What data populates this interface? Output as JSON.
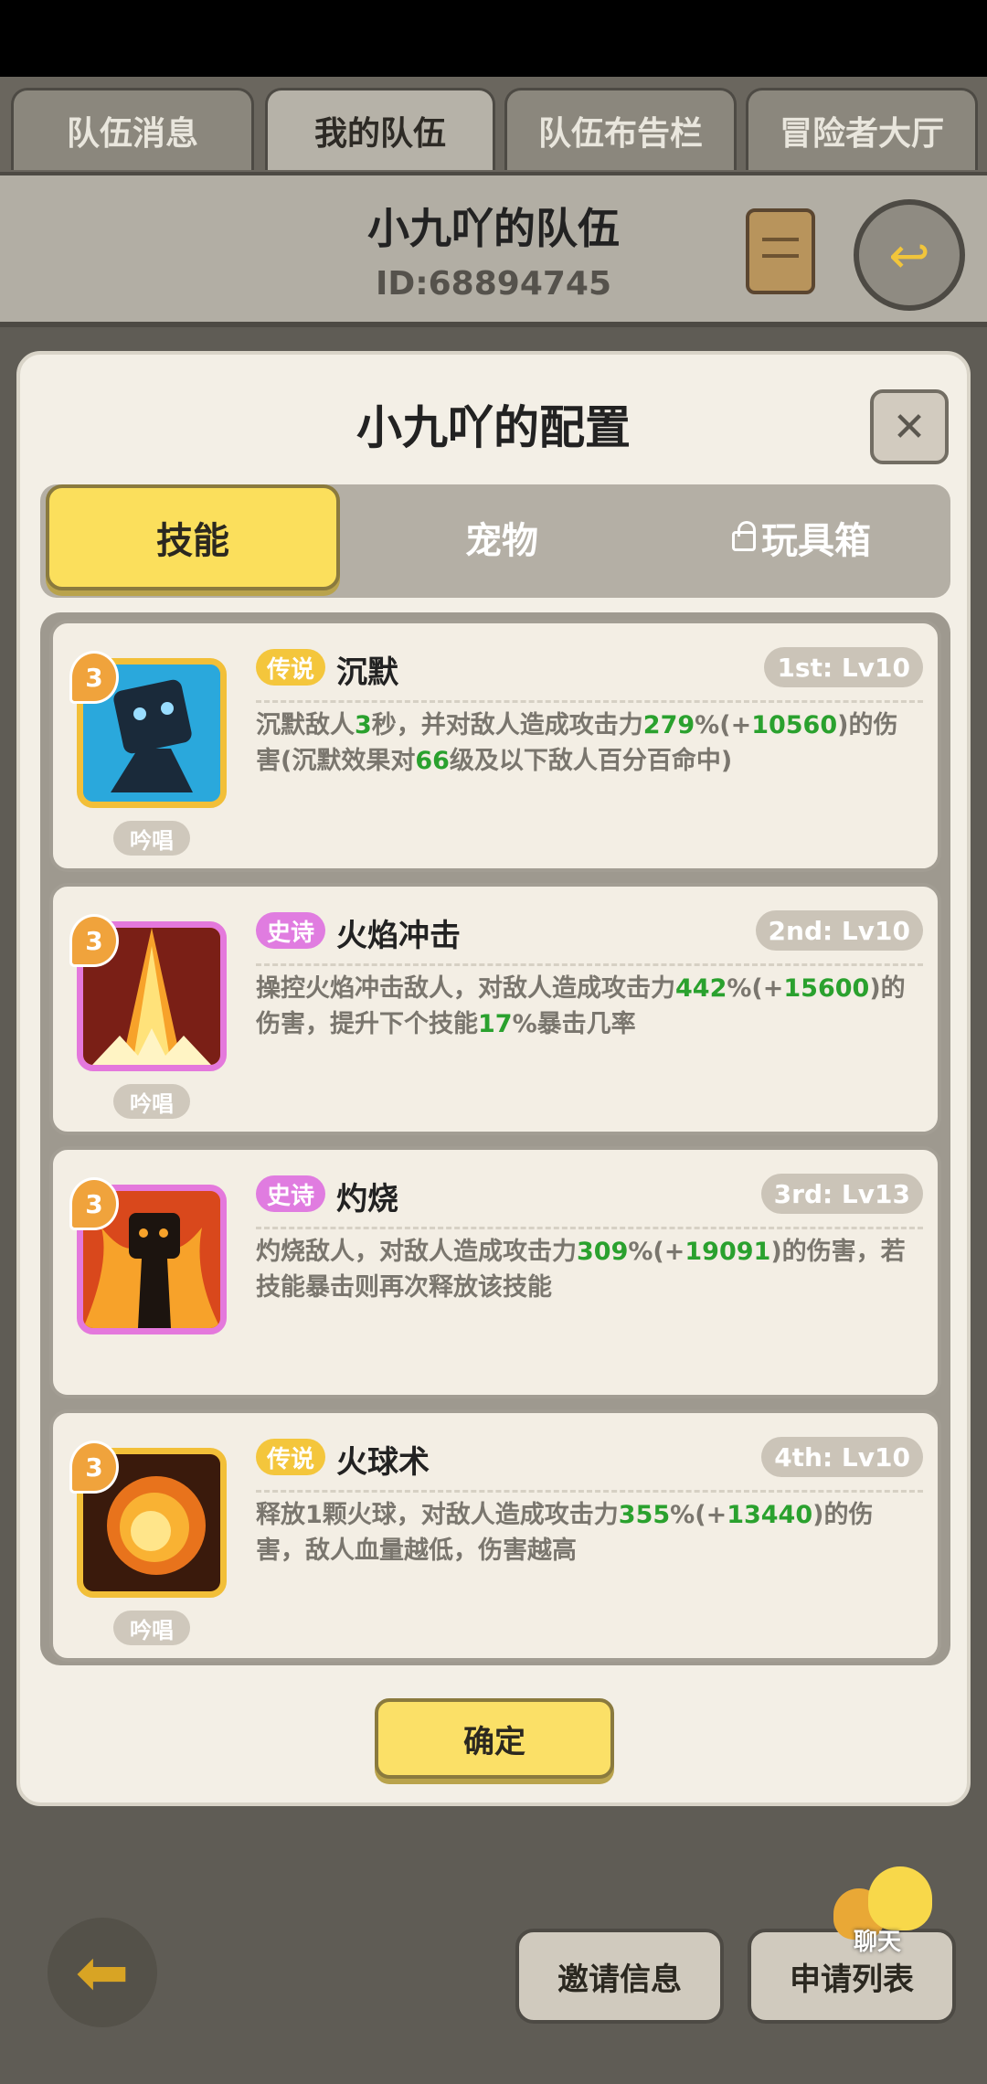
{
  "top_tabs": [
    "队伍消息",
    "我的队伍",
    "队伍布告栏",
    "冒险者大厅"
  ],
  "team": {
    "name": "小九吖的队伍",
    "id": "ID:68894745"
  },
  "modal": {
    "title": "小九吖的配置",
    "tabs": [
      "技能",
      "宠物",
      "玩具箱"
    ],
    "confirm_label": "确定"
  },
  "skills": [
    {
      "level": "3",
      "rarity": "传说",
      "name": "沉默",
      "slot": "1st: Lv10",
      "tag": "吟唱",
      "desc_parts": [
        "沉默敌人",
        "3",
        "秒，并对敌人造成攻击力",
        "279",
        "%(+",
        "10560",
        ")的伤害(沉默效果对",
        "66",
        "级及以下敌人百分百命中)"
      ]
    },
    {
      "level": "3",
      "rarity": "史诗",
      "name": "火焰冲击",
      "slot": "2nd: Lv10",
      "tag": "吟唱",
      "desc_parts": [
        "操控火焰冲击敌人，对敌人造成攻击力",
        "442",
        "%(+",
        "15600",
        ")的伤害，提升下个技能",
        "17",
        "%暴击几率"
      ]
    },
    {
      "level": "3",
      "rarity": "史诗",
      "name": "灼烧",
      "slot": "3rd: Lv13",
      "tag": "",
      "desc_parts": [
        "灼烧敌人，对敌人造成攻击力",
        "309",
        "%(+",
        "19091",
        ")的伤害，若技能暴击则再次释放该技能"
      ]
    },
    {
      "level": "3",
      "rarity": "传说",
      "name": "火球术",
      "slot": "4th: Lv10",
      "tag": "吟唱",
      "desc_parts": [
        "释放1颗火球，对敌人造成攻击力",
        "355",
        "%(+",
        "13440",
        ")的伤害，敌人血量越低，伤害越高"
      ]
    }
  ],
  "bottom": {
    "invite_label": "邀请信息",
    "apply_label": "申请列表",
    "chat_label": "聊天"
  },
  "colors": {
    "accent_yellow": "#fbdf5c",
    "green_value": "#2aa12e",
    "legend": "#f4c63c",
    "epic": "#e07ce0"
  }
}
